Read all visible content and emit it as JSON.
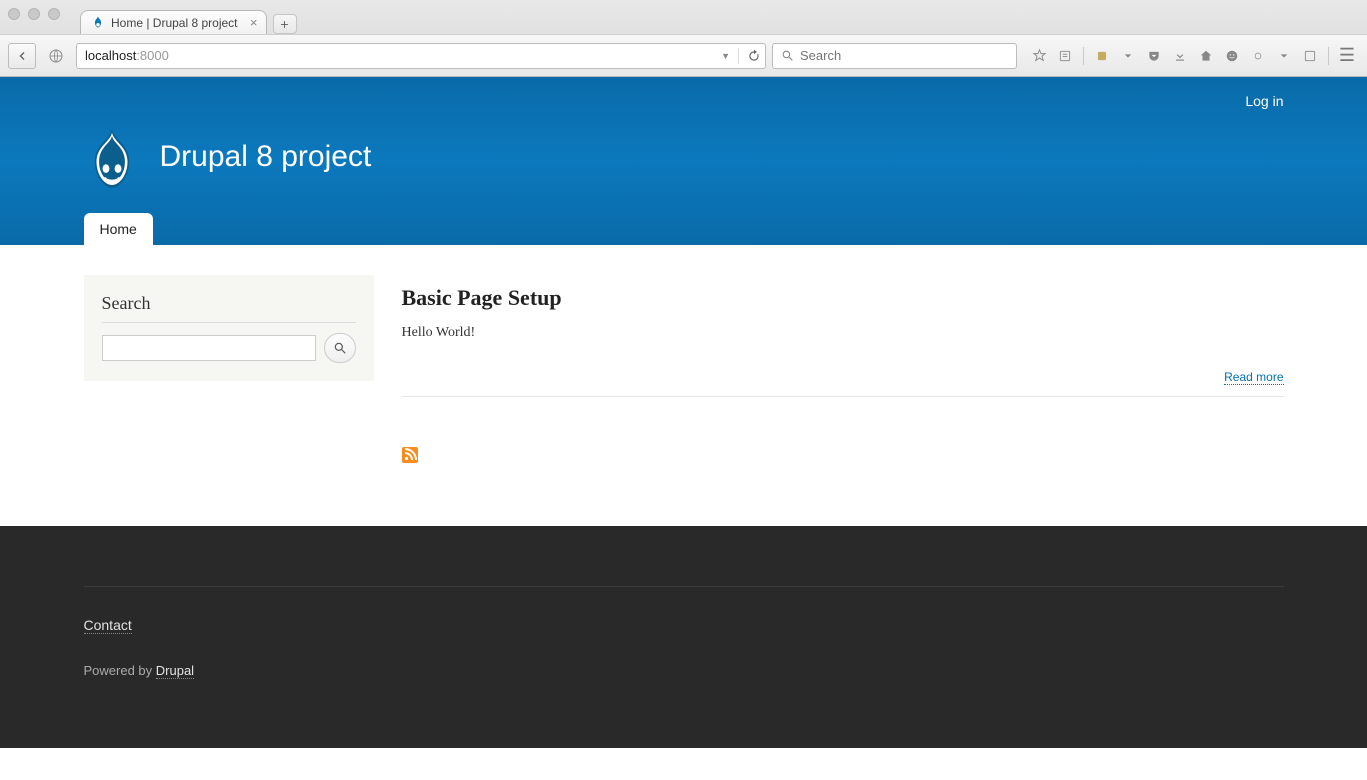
{
  "browser": {
    "tab_title": "Home | Drupal 8 project",
    "url_host": "localhost",
    "url_port": ":8000",
    "search_placeholder": "Search"
  },
  "header": {
    "login_label": "Log in",
    "site_name": "Drupal 8 project",
    "tabs": [
      {
        "label": "Home"
      }
    ]
  },
  "sidebar": {
    "search_heading": "Search"
  },
  "article": {
    "title": "Basic Page Setup",
    "body": "Hello World!",
    "read_more_label": "Read more"
  },
  "footer": {
    "contact_label": "Contact",
    "powered_prefix": "Powered by ",
    "powered_link": "Drupal"
  }
}
